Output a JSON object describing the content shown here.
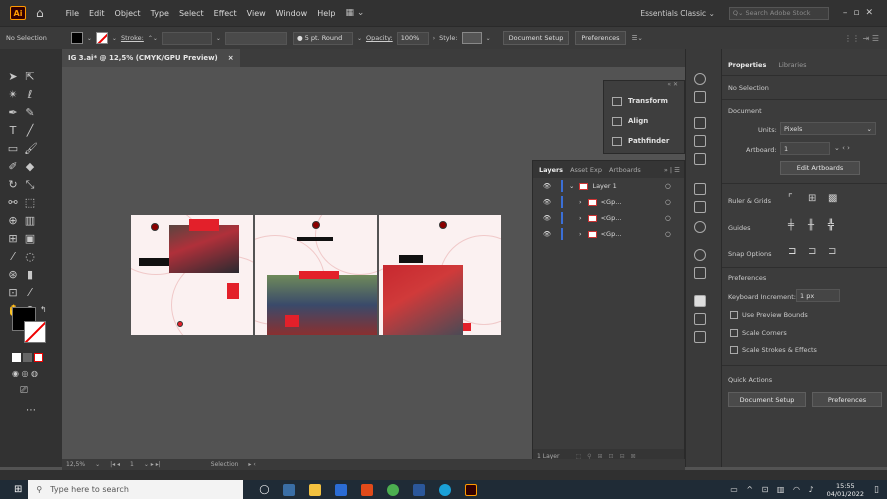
{
  "menubar": {
    "logo": "Ai",
    "items": [
      "File",
      "Edit",
      "Object",
      "Type",
      "Select",
      "Effect",
      "View",
      "Window",
      "Help"
    ],
    "workspace": "Essentials Classic",
    "search_placeholder": "Search Adobe Stock"
  },
  "controlbar": {
    "selection": "No Selection",
    "stroke_label": "Stroke:",
    "brush_label": "5 pt. Round",
    "opacity_label": "Opacity:",
    "opacity_value": "100%",
    "style_label": "Style:",
    "document_setup": "Document Setup",
    "preferences": "Preferences"
  },
  "document": {
    "tab_title": "IG 3.ai* @ 12,5% (CMYK/GPU Preview)",
    "close": "×"
  },
  "float_panel": {
    "items": [
      "Transform",
      "Align",
      "Pathfinder"
    ]
  },
  "layers_panel": {
    "tabs": [
      "Layers",
      "Asset Exp",
      "Artboards"
    ],
    "rows": [
      {
        "name": "Layer 1"
      },
      {
        "name": "<Gp..."
      },
      {
        "name": "<Gp..."
      },
      {
        "name": "<Gp..."
      }
    ],
    "footer": "1 Layer"
  },
  "properties": {
    "tabs": [
      "Properties",
      "Libraries"
    ],
    "no_selection": "No Selection",
    "document_heading": "Document",
    "units_label": "Units:",
    "units_value": "Pixels",
    "artboard_label": "Artboard:",
    "artboard_value": "1",
    "edit_artboards": "Edit Artboards",
    "ruler_grids": "Ruler & Grids",
    "guides": "Guides",
    "snap_options": "Snap Options",
    "preferences_heading": "Preferences",
    "keyboard_increment_label": "Keyboard Increment:",
    "keyboard_increment_value": "1 px",
    "use_preview_bounds": "Use Preview Bounds",
    "scale_corners": "Scale Corners",
    "scale_strokes": "Scale Strokes & Effects",
    "quick_actions": "Quick Actions",
    "document_setup_btn": "Document Setup",
    "preferences_btn": "Preferences"
  },
  "status": {
    "zoom": "12,5%",
    "artboard_nav": "1",
    "tool": "Selection"
  },
  "taskbar": {
    "search": "Type here to search",
    "time": "15:55",
    "date": "04/01/2022"
  }
}
